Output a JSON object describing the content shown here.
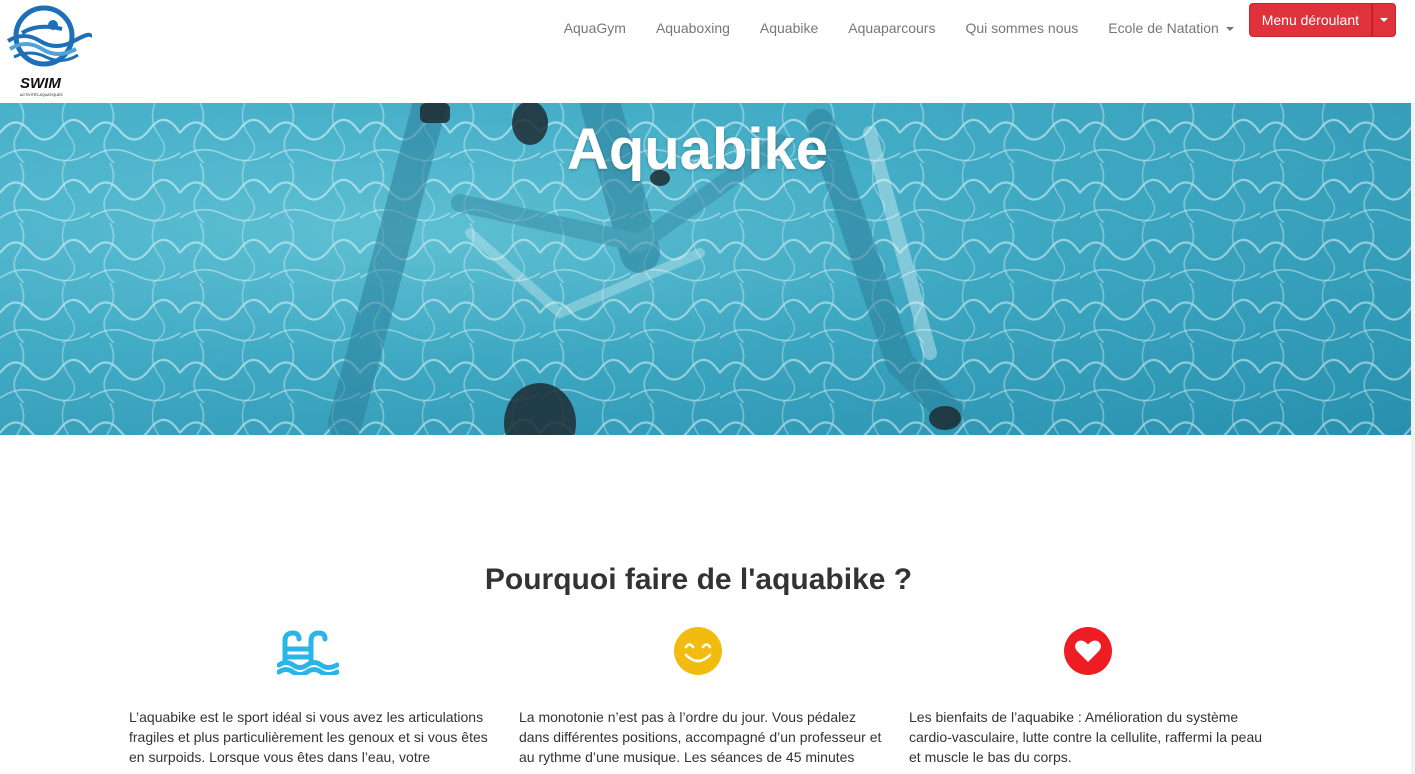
{
  "brand": {
    "logo_text": "SWIM",
    "logo_subtext": "ACTIVITÉS AQUATIQUES"
  },
  "nav": {
    "items": [
      {
        "label": "AquaGym"
      },
      {
        "label": "Aquaboxing"
      },
      {
        "label": "Aquabike"
      },
      {
        "label": "Aquaparcours"
      },
      {
        "label": "Qui sommes nous"
      }
    ],
    "dropdown_label": "Ecole de Natation",
    "split_button_label": "Menu déroulant"
  },
  "hero": {
    "title": "Aquabike"
  },
  "main": {
    "section_title": "Pourquoi faire de l'aquabike ?",
    "features": [
      {
        "icon": "pool-ladder-icon",
        "icon_color": "#29b6e6",
        "text": "L’aquabike est le sport idéal si vous avez les articulations fragiles et plus particulièrement les genoux et si vous êtes en surpoids. Lorsque vous êtes dans l’eau, votre"
      },
      {
        "icon": "smiley-icon",
        "icon_color": "#f1bc0f",
        "text": "La monotonie n’est pas à l’ordre du jour. Vous pédalez dans différentes positions, accompagné d’un professeur et au rythme d’une musique. Les séances de 45 minutes"
      },
      {
        "icon": "heart-icon",
        "icon_color": "#ee1c23",
        "text": "Les bienfaits de l’aquabike : Amélioration du système cardio-vasculaire, lutte contre la cellulite, raffermi la peau et muscle le bas du corps."
      }
    ]
  },
  "colors": {
    "accent_red": "#e0323c",
    "nav_text": "#777777",
    "logo_blue": "#1e6fb5"
  }
}
